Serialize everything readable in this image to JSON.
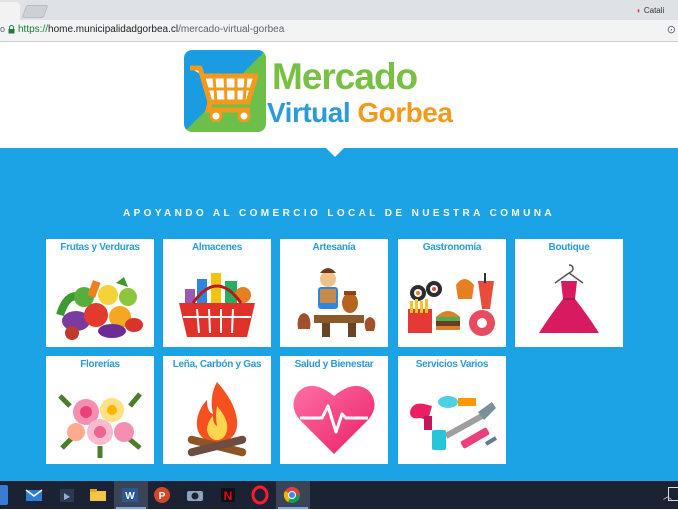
{
  "browser": {
    "tab_right_title": "Catali",
    "url_prefix": "https://",
    "url_host": "home.municipalidadgorbea.cl",
    "url_path": "/mercado-virtual-gorbea"
  },
  "logo": {
    "line1": "Mercado",
    "line2_part1": "Virtual",
    "line2_part2": "Gorbea"
  },
  "tagline": "APOYANDO AL COMERCIO LOCAL DE NUESTRA COMUNA",
  "categories": [
    {
      "label": "Frutas y Verduras",
      "icon": "fruits-vegetables-icon"
    },
    {
      "label": "Almacenes",
      "icon": "grocery-basket-icon"
    },
    {
      "label": "Artesanía",
      "icon": "potter-icon"
    },
    {
      "label": "Gastronomía",
      "icon": "food-icon"
    },
    {
      "label": "Boutique",
      "icon": "dress-icon"
    },
    {
      "label": "Florerías",
      "icon": "flowers-icon"
    },
    {
      "label": "Leña, Carbón y Gas",
      "icon": "fire-icon"
    },
    {
      "label": "Salud y Bienestar",
      "icon": "heart-pulse-icon"
    },
    {
      "label": "Servicios Varios",
      "icon": "tools-icon"
    }
  ],
  "taskbar": {
    "apps": [
      "start-icon",
      "mail-icon",
      "store-icon",
      "explorer-icon",
      "word-icon",
      "powerpoint-icon",
      "camera-icon",
      "netflix-icon",
      "opera-icon",
      "chrome-icon"
    ],
    "colors": {
      "word": "#2b579a",
      "powerpoint": "#d24726",
      "netflix": "#e50914",
      "opera": "#ff1b2d"
    }
  },
  "colors": {
    "banner_blue": "#1ba3e6",
    "label_blue": "#2a9ad8",
    "logo_green": "#77c043",
    "logo_orange": "#f39a1d"
  }
}
